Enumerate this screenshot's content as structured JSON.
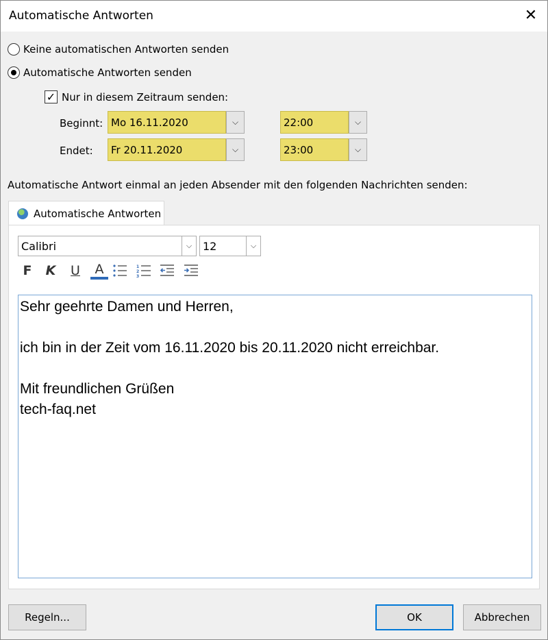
{
  "window": {
    "title": "Automatische Antworten"
  },
  "options": {
    "no_reply_label": "Keine automatischen Antworten senden",
    "reply_label": "Automatische Antworten senden",
    "time_range_label": "Nur in diesem Zeitraum senden:",
    "selected": "reply",
    "time_range_checked": true
  },
  "schedule": {
    "start_label": "Beginnt:",
    "start_date": "Mo 16.11.2020",
    "start_time": "22:00",
    "end_label": "Endet:",
    "end_date": "Fr 20.11.2020",
    "end_time": "23:00",
    "highlight_color": "#ebdd6b"
  },
  "description": "Automatische Antwort einmal an jeden Absender mit den folgenden Nachrichten senden:",
  "tab": {
    "label": "Automatische Antworten"
  },
  "format": {
    "font": "Calibri",
    "size": "12",
    "bold": "F",
    "italic": "K",
    "underline": "U",
    "font_color": "A",
    "font_color_hex": "#2e6ab8"
  },
  "message": {
    "lines": [
      "Sehr geehrte Damen und Herren,",
      "",
      "ich bin in der Zeit vom 16.11.2020 bis 20.11.2020 nicht erreichbar.",
      "",
      "Mit freundlichen Grüßen",
      "tech-faq.net"
    ]
  },
  "buttons": {
    "rules": "Regeln...",
    "ok": "OK",
    "cancel": "Abbrechen"
  }
}
